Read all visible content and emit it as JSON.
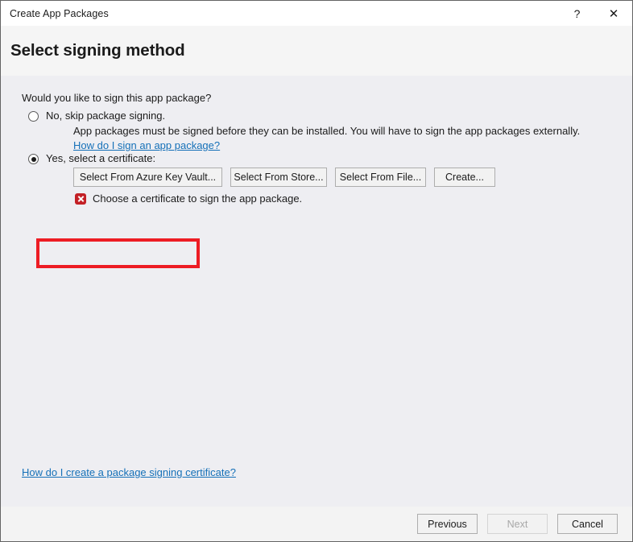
{
  "window": {
    "title": "Create App Packages",
    "help_label": "?",
    "close_label": "✕"
  },
  "header": {
    "title": "Select signing method"
  },
  "main": {
    "question": "Would you like to sign this app package?",
    "options": [
      {
        "id": "no-skip",
        "label": "No, skip package signing.",
        "selected": false,
        "description": "App packages must be signed before they can be installed. You will have to sign the app packages externally.",
        "link": "How do I sign an app package?"
      },
      {
        "id": "yes-certificate",
        "label": "Yes, select a certificate:",
        "selected": true
      }
    ],
    "certificate_buttons": [
      {
        "id": "azure-key-vault",
        "label": "Select From Azure Key Vault...",
        "highlighted": true
      },
      {
        "id": "store",
        "label": "Select From Store...",
        "highlighted": false
      },
      {
        "id": "file",
        "label": "Select From File...",
        "highlighted": false
      },
      {
        "id": "create",
        "label": "Create...",
        "highlighted": false
      }
    ],
    "error": {
      "icon": "error-x-icon",
      "text": "Choose a certificate to sign the app package."
    },
    "bottom_link": "How do I create a package signing certificate?"
  },
  "footer": {
    "buttons": [
      {
        "id": "previous",
        "label": "Previous",
        "enabled": true
      },
      {
        "id": "next",
        "label": "Next",
        "enabled": false
      },
      {
        "id": "cancel",
        "label": "Cancel",
        "enabled": true
      }
    ]
  },
  "colors": {
    "accent_link": "#1570b8",
    "error_red": "#c32026",
    "highlight_red": "#ed1c24",
    "content_bg": "#eeeef2",
    "header_bg": "#f5f5f5",
    "footer_bg": "#f3f3f3"
  }
}
